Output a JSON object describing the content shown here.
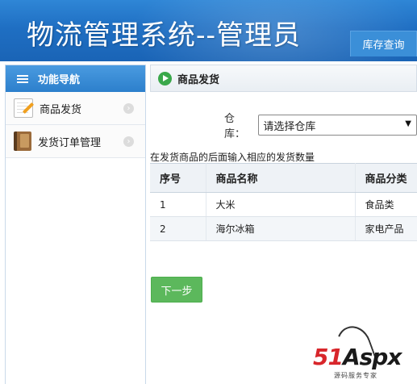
{
  "header": {
    "title": "物流管理系统--管理员",
    "top_tab": "库存查询"
  },
  "sidebar": {
    "heading": "功能导航",
    "items": [
      {
        "label": "商品发货",
        "icon": "pencil-icon"
      },
      {
        "label": "发货订单管理",
        "icon": "book-icon"
      }
    ]
  },
  "main": {
    "title": "商品发货",
    "warehouse_label": "仓库：",
    "warehouse_selected": "请选择仓库",
    "hint": "在发货商品的后面输入相应的发货数量",
    "columns": [
      "序号",
      "商品名称",
      "商品分类"
    ],
    "rows": [
      [
        "1",
        "大米",
        "食品类"
      ],
      [
        "2",
        "海尔冰箱",
        "家电产品"
      ]
    ],
    "next_button": "下一步"
  },
  "watermark": {
    "logo_red": "51",
    "logo_dark": "Aspx",
    "tagline": "源码服务专家"
  },
  "colors": {
    "header_blue": "#1f6fc3",
    "accent_green": "#5cb85c",
    "watermark_red": "#d8262b"
  }
}
